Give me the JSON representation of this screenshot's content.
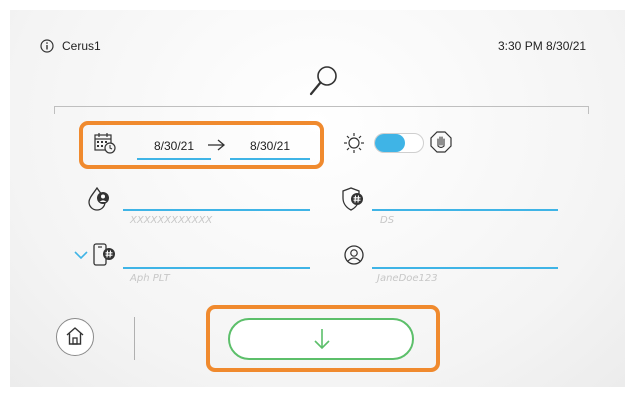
{
  "header": {
    "device_name": "Cerus1",
    "datetime": "3:30 PM 8/30/21",
    "icons": {
      "info": "info-icon",
      "search": "search-icon"
    }
  },
  "date_range": {
    "start": "8/30/21",
    "end": "8/30/21",
    "icons": {
      "calendar": "calendar-clock-icon",
      "arrow": "arrow-right-icon"
    }
  },
  "mode": {
    "toggle_state": "on",
    "icons": {
      "sun": "sun-icon",
      "hand": "hand-stop-icon"
    },
    "toggle_color": "#3fb4e6"
  },
  "fields": {
    "donor_id": {
      "value": "",
      "placeholder": "XXXXXXXXXXXX",
      "icon": "blood-drop-user-icon"
    },
    "ds": {
      "value": "",
      "placeholder": "DS",
      "icon": "shield-hash-icon"
    },
    "product": {
      "value": "",
      "placeholder": "Aph PLT",
      "icon": "device-hash-icon",
      "dropdown_icon": "chevron-down-icon"
    },
    "operator": {
      "value": "",
      "placeholder": "JaneDoe123",
      "icon": "user-circle-icon"
    }
  },
  "footer": {
    "icons": {
      "home": "home-icon",
      "download": "arrow-down-icon"
    }
  },
  "colors": {
    "accent_blue": "#3fb4e6",
    "highlight_orange": "#f08a2e",
    "button_green": "#5cbf6a"
  }
}
